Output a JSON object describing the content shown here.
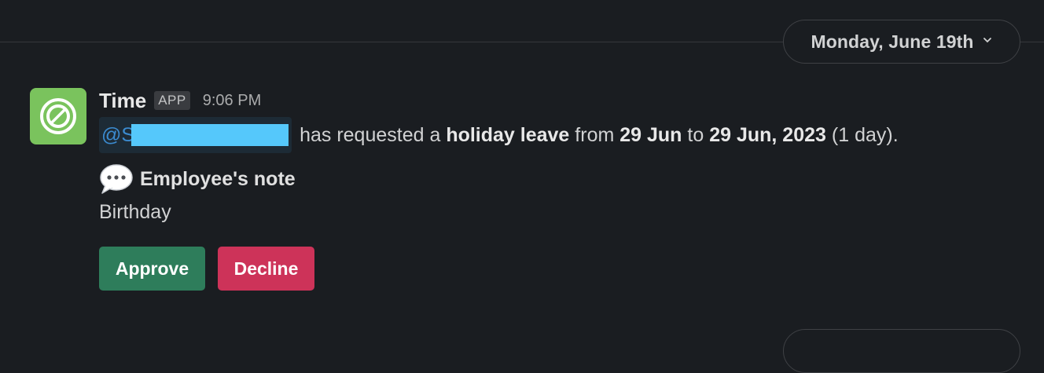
{
  "date_divider": {
    "label": "Monday, June 19th",
    "chevron_icon": "chevron-down-icon"
  },
  "message": {
    "sender": "Time",
    "badge": "APP",
    "time": "9:06 PM",
    "avatar_icon": "time-app-logo-icon",
    "avatar_color": "#7ac35d",
    "mention_prefix": "@S",
    "text": {
      "part1": "has requested a",
      "leave_type": "holiday leave",
      "part2": "from",
      "start_date": "29 Jun",
      "part3": "to",
      "end_date": "29 Jun, 2023",
      "duration": "(1 day)."
    },
    "note": {
      "icon": "speech-bubble-icon",
      "title": "Employee's note",
      "body": "Birthday"
    },
    "actions": {
      "approve_label": "Approve",
      "decline_label": "Decline",
      "approve_color": "#2e7d5b",
      "decline_color": "#cd3359"
    }
  }
}
